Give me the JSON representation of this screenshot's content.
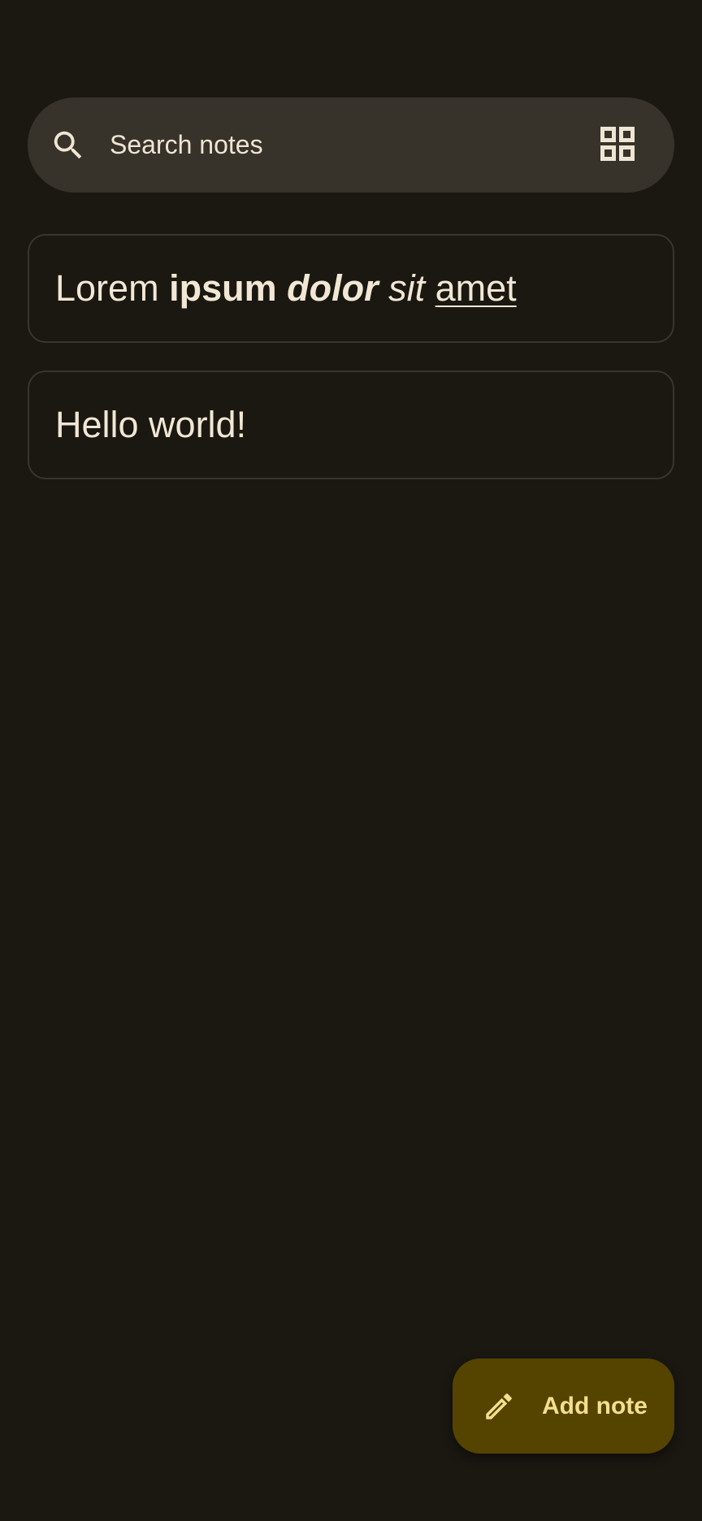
{
  "search": {
    "placeholder": "Search notes",
    "icon": "search-icon",
    "layout_toggle_icon": "grid-view-icon"
  },
  "notes": [
    {
      "segments": [
        {
          "text": "Lorem",
          "style": "normal"
        },
        {
          "text": " ",
          "style": "normal"
        },
        {
          "text": "ipsum",
          "style": "bold"
        },
        {
          "text": " ",
          "style": "normal"
        },
        {
          "text": "dolor",
          "style": "bold-italic"
        },
        {
          "text": " ",
          "style": "normal"
        },
        {
          "text": "sit",
          "style": "italic"
        },
        {
          "text": " ",
          "style": "normal"
        },
        {
          "text": "amet",
          "style": "underline"
        }
      ]
    },
    {
      "segments": [
        {
          "text": "Hello world!",
          "style": "normal"
        }
      ]
    }
  ],
  "fab": {
    "label": "Add note",
    "icon": "pencil-icon"
  },
  "colors": {
    "background": "#1b1812",
    "search_bar": "#37322a",
    "card_border": "#3a352c",
    "text": "#f1e7d4",
    "fab_background": "#554400",
    "fab_foreground": "#f4df8e"
  }
}
